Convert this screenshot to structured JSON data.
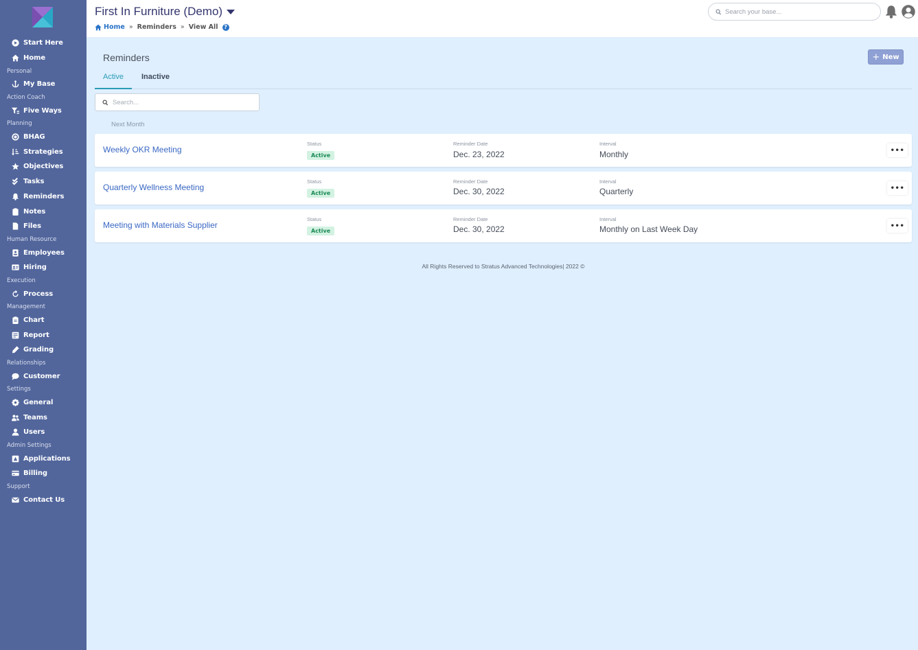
{
  "sidebar": {
    "items": [
      {
        "label": "Start Here",
        "icon": "play-circle-icon"
      },
      {
        "label": "Home",
        "icon": "home-icon"
      },
      {
        "label": "My Base",
        "icon": "anchor-icon"
      },
      {
        "label": "Five Ways",
        "icon": "filter-icon"
      },
      {
        "label": "BHAG",
        "icon": "target-icon"
      },
      {
        "label": "Strategies",
        "icon": "sort-icon"
      },
      {
        "label": "Objectives",
        "icon": "star-icon"
      },
      {
        "label": "Tasks",
        "icon": "check-double-icon"
      },
      {
        "label": "Reminders",
        "icon": "bell-icon"
      },
      {
        "label": "Notes",
        "icon": "clipboard-icon"
      },
      {
        "label": "Files",
        "icon": "file-icon"
      },
      {
        "label": "Employees",
        "icon": "id-badge-icon"
      },
      {
        "label": "Hiring",
        "icon": "id-card-icon"
      },
      {
        "label": "Process",
        "icon": "redo-icon"
      },
      {
        "label": "Chart",
        "icon": "clipboard-list-icon"
      },
      {
        "label": "Report",
        "icon": "report-icon"
      },
      {
        "label": "Grading",
        "icon": "pen-icon"
      },
      {
        "label": "Customer",
        "icon": "comment-icon"
      },
      {
        "label": "General",
        "icon": "cog-icon"
      },
      {
        "label": "Teams",
        "icon": "users-icon"
      },
      {
        "label": "Users",
        "icon": "user-icon"
      },
      {
        "label": "Applications",
        "icon": "app-icon"
      },
      {
        "label": "Billing",
        "icon": "credit-card-icon"
      },
      {
        "label": "Contact Us",
        "icon": "envelope-icon"
      }
    ],
    "sections": [
      "Personal",
      "Action Coach",
      "Planning",
      "Human Resource",
      "Execution",
      "Management",
      "Relationships",
      "Settings",
      "Admin Settings",
      "Support"
    ]
  },
  "header": {
    "title": "First In Furniture (Demo)",
    "breadcrumb": {
      "home": "Home",
      "sep": "»",
      "middle": "Reminders",
      "last": "View All",
      "help": "?"
    },
    "search_placeholder": "Search your base..."
  },
  "main": {
    "title": "Reminders",
    "new_label": "New",
    "new_plus": "+",
    "tabs": {
      "active": "Active",
      "inactive": "Inactive"
    },
    "search_placeholder": "Search...",
    "group_label": "Next Month",
    "captions": {
      "status": "Status",
      "date": "Reminder Date",
      "interval": "Interval"
    },
    "more_label": "•••",
    "reminders": [
      {
        "name": "Weekly OKR Meeting",
        "status": "Active",
        "date": "Dec. 23, 2022",
        "interval": "Monthly"
      },
      {
        "name": "Quarterly Wellness Meeting",
        "status": "Active",
        "date": "Dec. 30, 2022",
        "interval": "Quarterly"
      },
      {
        "name": "Meeting with Materials Supplier",
        "status": "Active",
        "date": "Dec. 30, 2022",
        "interval": "Monthly on Last Week Day"
      }
    ],
    "footer": "All Rights Reserved to Stratus Advanced Technologies| 2022 ©"
  },
  "colors": {
    "sidebar": "#52669c",
    "background": "#dfeffd",
    "accent": "#2a9cb7",
    "link": "#3a68c4",
    "badge_bg": "#d3f2e2",
    "badge_text": "#1c8a57",
    "title": "#33356e"
  }
}
